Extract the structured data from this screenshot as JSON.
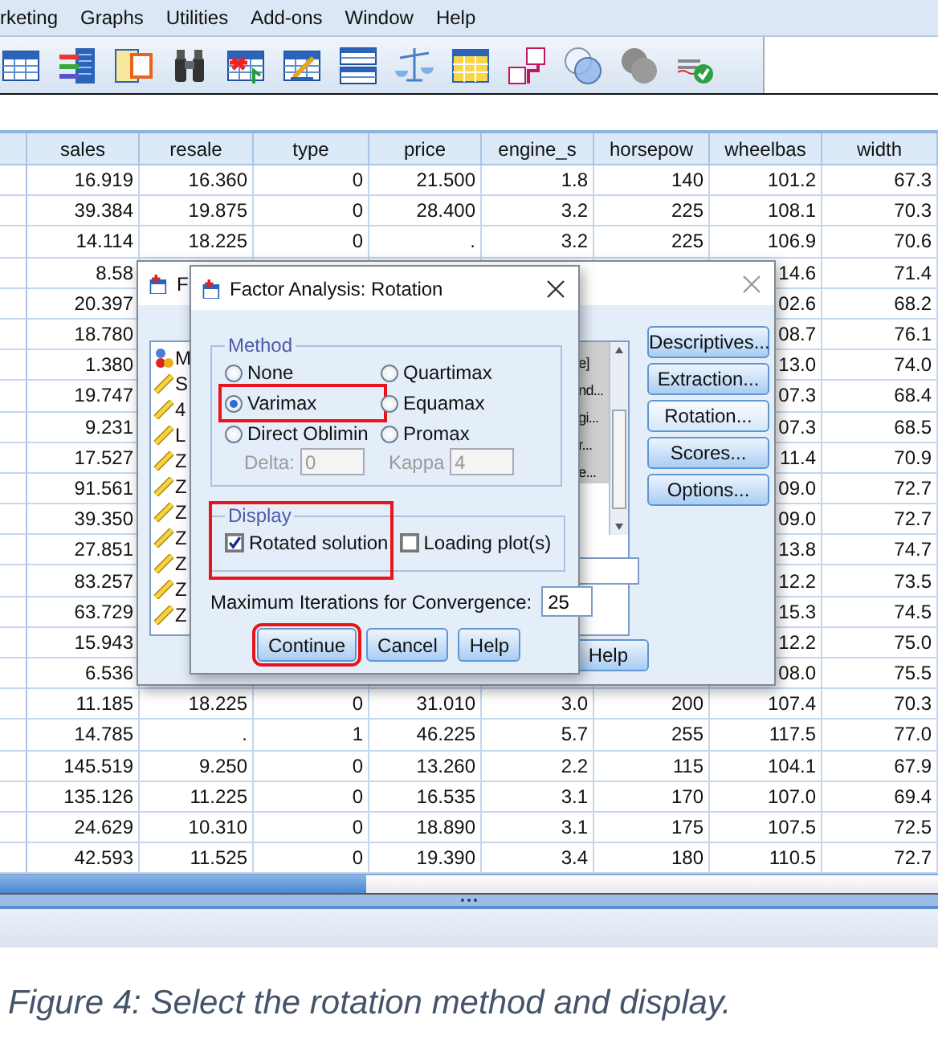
{
  "menu": [
    "rketing",
    "Graphs",
    "Utilities",
    "Add-ons",
    "Window",
    "Help"
  ],
  "grid": {
    "columns": [
      "sales",
      "resale",
      "type",
      "price",
      "engine_s",
      "horsepow",
      "wheelbas",
      "width"
    ],
    "rows": [
      [
        "16.919",
        "16.360",
        "0",
        "21.500",
        "1.8",
        "140",
        "101.2",
        "67.3"
      ],
      [
        "39.384",
        "19.875",
        "0",
        "28.400",
        "3.2",
        "225",
        "108.1",
        "70.3"
      ],
      [
        "14.114",
        "18.225",
        "0",
        ".",
        "3.2",
        "225",
        "106.9",
        "70.6"
      ],
      [
        "8.58",
        null,
        null,
        null,
        null,
        null,
        "14.6",
        "71.4"
      ],
      [
        "20.397",
        null,
        null,
        null,
        null,
        null,
        "02.6",
        "68.2"
      ],
      [
        "18.780",
        null,
        null,
        null,
        null,
        null,
        "08.7",
        "76.1"
      ],
      [
        "1.380",
        null,
        null,
        null,
        null,
        null,
        "13.0",
        "74.0"
      ],
      [
        "19.747",
        null,
        null,
        null,
        null,
        null,
        "07.3",
        "68.4"
      ],
      [
        "9.231",
        null,
        null,
        null,
        null,
        null,
        "07.3",
        "68.5"
      ],
      [
        "17.527",
        null,
        null,
        null,
        null,
        null,
        "11.4",
        "70.9"
      ],
      [
        "91.561",
        null,
        null,
        null,
        null,
        null,
        "09.0",
        "72.7"
      ],
      [
        "39.350",
        null,
        null,
        null,
        null,
        null,
        "09.0",
        "72.7"
      ],
      [
        "27.851",
        null,
        null,
        null,
        null,
        null,
        "13.8",
        "74.7"
      ],
      [
        "83.257",
        null,
        null,
        null,
        null,
        null,
        "12.2",
        "73.5"
      ],
      [
        "63.729",
        null,
        null,
        null,
        null,
        null,
        "15.3",
        "74.5"
      ],
      [
        "15.943",
        null,
        null,
        null,
        null,
        null,
        "12.2",
        "75.0"
      ],
      [
        "6.536",
        null,
        null,
        null,
        null,
        null,
        "08.0",
        "75.5"
      ],
      [
        "11.185",
        "18.225",
        "0",
        "31.010",
        "3.0",
        "200",
        "107.4",
        "70.3"
      ],
      [
        "14.785",
        ".",
        "1",
        "46.225",
        "5.7",
        "255",
        "117.5",
        "77.0"
      ],
      [
        "145.519",
        "9.250",
        "0",
        "13.260",
        "2.2",
        "115",
        "104.1",
        "67.9"
      ],
      [
        "135.126",
        "11.225",
        "0",
        "16.535",
        "3.1",
        "170",
        "107.0",
        "69.4"
      ],
      [
        "24.629",
        "10.310",
        "0",
        "18.890",
        "3.1",
        "175",
        "107.5",
        "72.5"
      ],
      [
        "42.593",
        "11.525",
        "0",
        "19.390",
        "3.4",
        "180",
        "110.5",
        "72.7"
      ]
    ]
  },
  "main_dialog": {
    "title": "F",
    "variables": [
      {
        "kind": "nominal",
        "text": "M"
      },
      {
        "kind": "scale",
        "text": "S"
      },
      {
        "kind": "scale",
        "text": "4"
      },
      {
        "kind": "scale",
        "text": "L"
      },
      {
        "kind": "scale",
        "text": "Z"
      },
      {
        "kind": "scale",
        "text": "Z"
      },
      {
        "kind": "scale",
        "text": "Z"
      },
      {
        "kind": "scale",
        "text": "Z"
      },
      {
        "kind": "scale",
        "text": "Z"
      },
      {
        "kind": "scale",
        "text": "Z"
      },
      {
        "kind": "scale",
        "text": "Z"
      }
    ],
    "selected_variables": [
      "e]",
      "nd...",
      "gi...",
      "r...",
      "e..."
    ],
    "buttons": [
      "Descriptives...",
      "Extraction...",
      "Rotation...",
      "Scores...",
      "Options..."
    ],
    "help_button": "Help"
  },
  "rotation_dialog": {
    "title": "Factor Analysis: Rotation",
    "method": {
      "label": "Method",
      "options": [
        {
          "label": "None",
          "selected": false,
          "highlighted": false
        },
        {
          "label": "Quartimax",
          "selected": false,
          "highlighted": false
        },
        {
          "label": "Varimax",
          "selected": true,
          "highlighted": true
        },
        {
          "label": "Equamax",
          "selected": false,
          "highlighted": false
        },
        {
          "label": "Direct Oblimin",
          "selected": false,
          "highlighted": false
        },
        {
          "label": "Promax",
          "selected": false,
          "highlighted": false
        }
      ],
      "delta": {
        "label": "Delta:",
        "value": "0",
        "disabled": true
      },
      "kappa": {
        "label": "Kappa",
        "value": "4",
        "disabled": true
      }
    },
    "display": {
      "label": "Display",
      "highlighted": true,
      "options": [
        {
          "label": "Rotated solution",
          "checked": true
        },
        {
          "label": "Loading plot(s)",
          "checked": false
        }
      ]
    },
    "max_iterations": {
      "label": "Maximum Iterations for Convergence:",
      "value": "25"
    },
    "buttons": [
      {
        "label": "Continue",
        "highlighted": true
      },
      {
        "label": "Cancel",
        "highlighted": false
      },
      {
        "label": "Help",
        "highlighted": false
      }
    ]
  },
  "caption": "Figure 4: Select the rotation method and display."
}
